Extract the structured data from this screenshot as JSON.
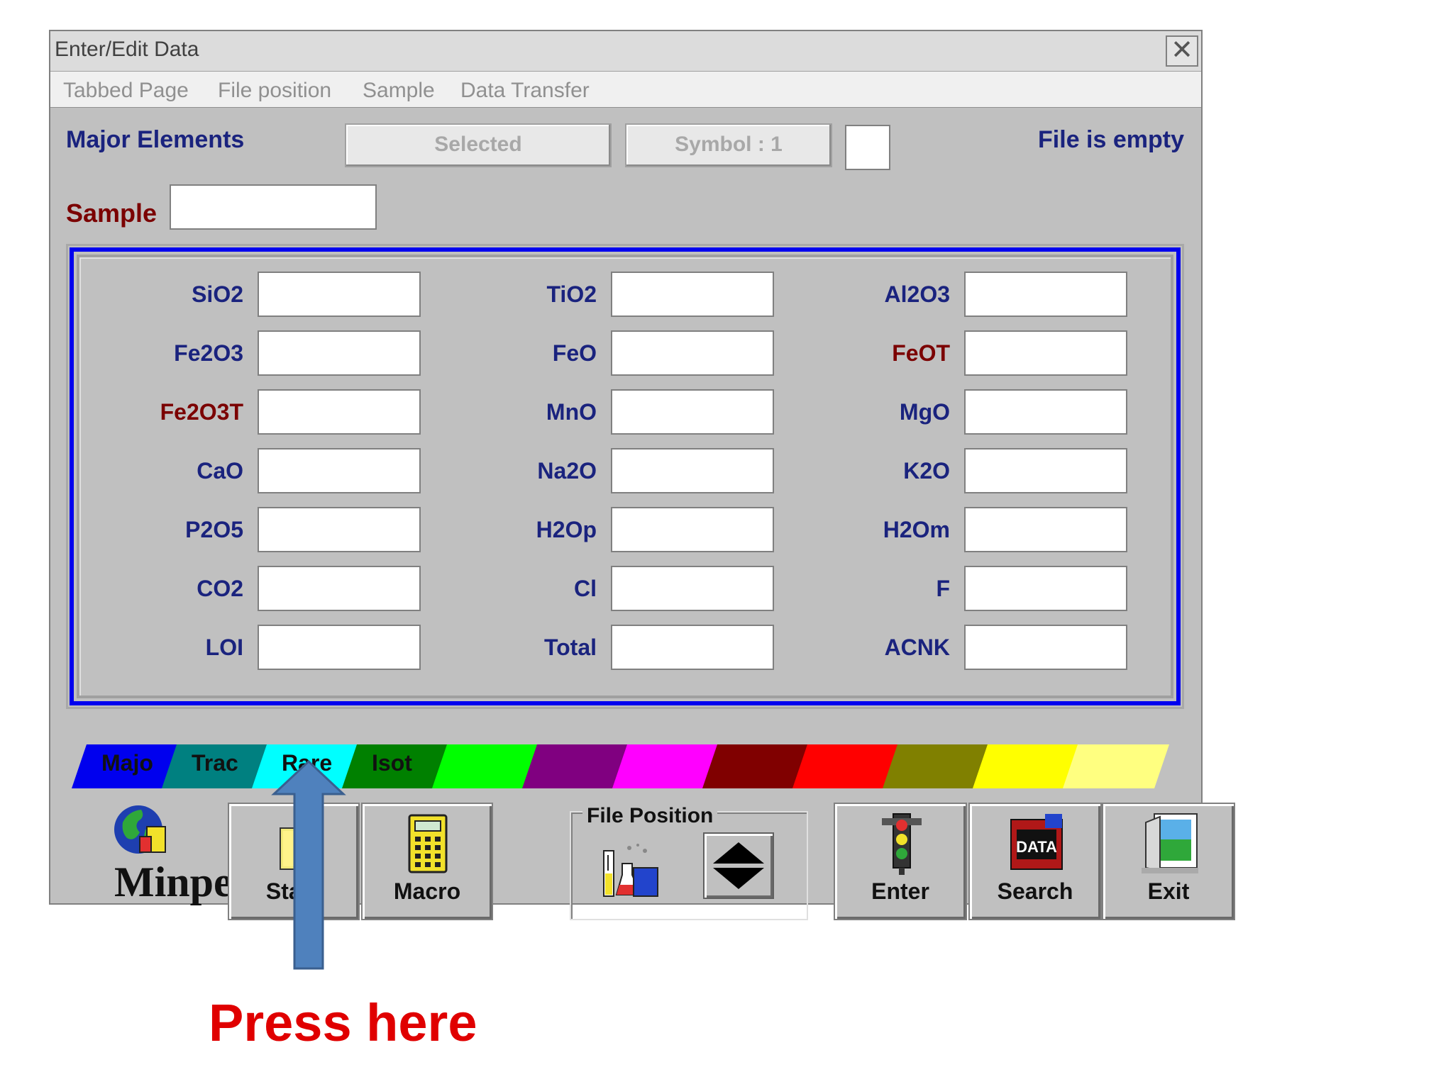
{
  "window": {
    "title": "Enter/Edit Data",
    "close_glyph": "✕"
  },
  "menu": [
    "Tabbed Page",
    "File position",
    "Sample",
    "Data Transfer"
  ],
  "header": {
    "section_title": "Major Elements",
    "selected_button": "Selected",
    "symbol_button": "Symbol : 1",
    "file_status": "File is empty",
    "sample_label": "Sample",
    "sample_value": ""
  },
  "fields": [
    {
      "label": "SiO2",
      "color": "#1a237e"
    },
    {
      "label": "TiO2",
      "color": "#1a237e"
    },
    {
      "label": "Al2O3",
      "color": "#1a237e"
    },
    {
      "label": "Fe2O3",
      "color": "#1a237e"
    },
    {
      "label": "FeO",
      "color": "#1a237e"
    },
    {
      "label": "FeOT",
      "color": "#7b0000"
    },
    {
      "label": "Fe2O3T",
      "color": "#7b0000"
    },
    {
      "label": "MnO",
      "color": "#1a237e"
    },
    {
      "label": "MgO",
      "color": "#1a237e"
    },
    {
      "label": "CaO",
      "color": "#1a237e"
    },
    {
      "label": "Na2O",
      "color": "#1a237e"
    },
    {
      "label": "K2O",
      "color": "#1a237e"
    },
    {
      "label": "P2O5",
      "color": "#1a237e"
    },
    {
      "label": "H2Op",
      "color": "#1a237e"
    },
    {
      "label": "H2Om",
      "color": "#1a237e"
    },
    {
      "label": "CO2",
      "color": "#1a237e"
    },
    {
      "label": "Cl",
      "color": "#1a237e"
    },
    {
      "label": "F",
      "color": "#1a237e"
    },
    {
      "label": "LOI",
      "color": "#1a237e"
    },
    {
      "label": "Total",
      "color": "#1a237e"
    },
    {
      "label": "ACNK",
      "color": "#1a237e"
    }
  ],
  "tabs": [
    {
      "label": "Majo",
      "color": "#0000ee",
      "text_color": "#111111"
    },
    {
      "label": "Trac",
      "color": "#008080",
      "text_color": "#111111"
    },
    {
      "label": "Rare",
      "color": "#00ffff",
      "text_color": "#111111"
    },
    {
      "label": "Isot",
      "color": "#008000",
      "text_color": "#111111"
    },
    {
      "label": "",
      "color": "#00ff00",
      "text_color": "#111111"
    },
    {
      "label": "",
      "color": "#800080",
      "text_color": "#111111"
    },
    {
      "label": "",
      "color": "#ff00ff",
      "text_color": "#111111"
    },
    {
      "label": "",
      "color": "#800000",
      "text_color": "#111111"
    },
    {
      "label": "",
      "color": "#ff0000",
      "text_color": "#111111"
    },
    {
      "label": "",
      "color": "#808000",
      "text_color": "#111111"
    },
    {
      "label": "",
      "color": "#ffff00",
      "text_color": "#111111"
    },
    {
      "label": "",
      "color": "#ffff80",
      "text_color": "#111111"
    }
  ],
  "toolbar": {
    "logo_text": "Minpet",
    "stats_label": "Stats",
    "macro_label": "Macro",
    "file_position_title": "File Position",
    "enter_label": "Enter",
    "search_label": "Search",
    "exit_label": "Exit",
    "data_icon_text": "DATA"
  },
  "annotation": {
    "text": "Press here",
    "arrow_color": "#4f81bd",
    "text_color": "#e00000"
  }
}
